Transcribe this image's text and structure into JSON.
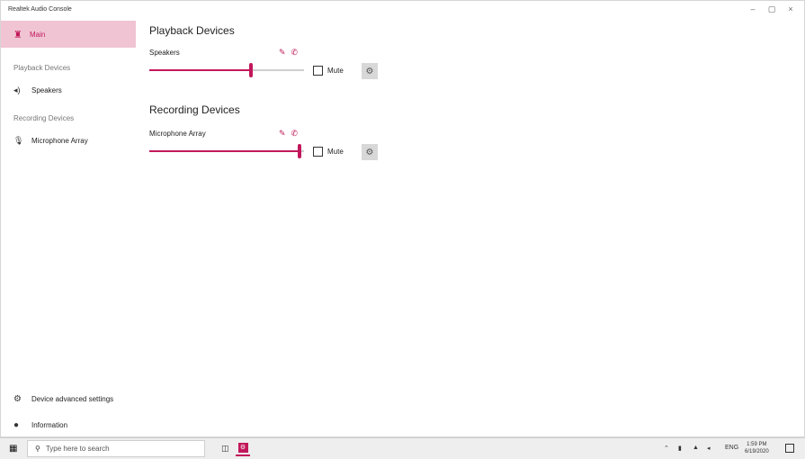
{
  "window": {
    "title": "Realtek Audio Console",
    "controls": {
      "minimize": "–",
      "maximize": "▢",
      "close": "×"
    }
  },
  "sidebar": {
    "main_label": "Main",
    "playback_header": "Playback Devices",
    "playback_items": [
      {
        "label": "Speakers",
        "icon": "speaker-icon"
      }
    ],
    "recording_header": "Recording Devices",
    "recording_items": [
      {
        "label": "Microphone Array",
        "icon": "microphone-icon"
      }
    ],
    "bottom": {
      "advanced_label": "Device advanced settings",
      "info_label": "Information"
    }
  },
  "main": {
    "playback": {
      "heading": "Playback Devices",
      "device_name": "Speakers",
      "volume_fraction": 0.66,
      "mute_label": "Mute",
      "muted": false
    },
    "recording": {
      "heading": "Recording Devices",
      "device_name": "Microphone Array",
      "volume_fraction": 0.98,
      "mute_label": "Mute",
      "muted": false
    }
  },
  "taskbar": {
    "search_placeholder": "Type here to search",
    "tray": {
      "lang": "ENG"
    },
    "clock": {
      "time": "1:59 PM",
      "date": "6/19/2020"
    }
  },
  "colors": {
    "accent": "#c2185b",
    "selected_bg": "#f0c4d3"
  }
}
